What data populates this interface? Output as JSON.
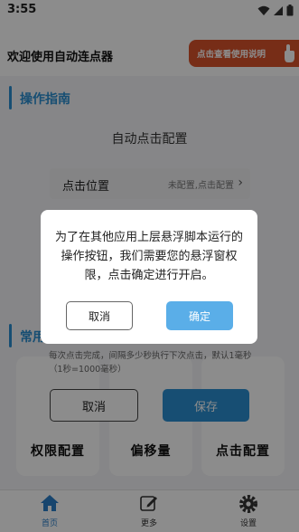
{
  "status_bar": {
    "time": "3:55"
  },
  "header": {
    "title": "欢迎使用自动连点器",
    "help_button": "点击查看使用说明"
  },
  "section_guide": {
    "title": "操作指南"
  },
  "auto_click_card": {
    "title": "自动点击配置",
    "row_label": "点击位置",
    "row_value": "未配置,点击配置",
    "help_text": "每次点击完成，间隔多少秒执行下次点击，默认1毫秒（1秒=1000毫秒）",
    "cancel_label": "取消",
    "save_label": "保存"
  },
  "section_common": {
    "title": "常用"
  },
  "tiles": [
    {
      "label": "权限配置"
    },
    {
      "label": "偏移量"
    },
    {
      "label": "点击配置"
    }
  ],
  "bottom_nav": [
    {
      "label": "首页",
      "icon": "home-icon",
      "active": true
    },
    {
      "label": "更多",
      "icon": "edit-icon",
      "active": false
    },
    {
      "label": "设置",
      "icon": "gear-icon",
      "active": false
    }
  ],
  "dialog": {
    "message": "为了在其他应用上层悬浮脚本运行的操作按钮，我们需要您的悬浮窗权限，点击确定进行开启。",
    "cancel_label": "取消",
    "confirm_label": "确定"
  },
  "colors": {
    "accent": "#2a8fd1",
    "help_button": "#d9532b",
    "confirm": "#5aaee8"
  }
}
